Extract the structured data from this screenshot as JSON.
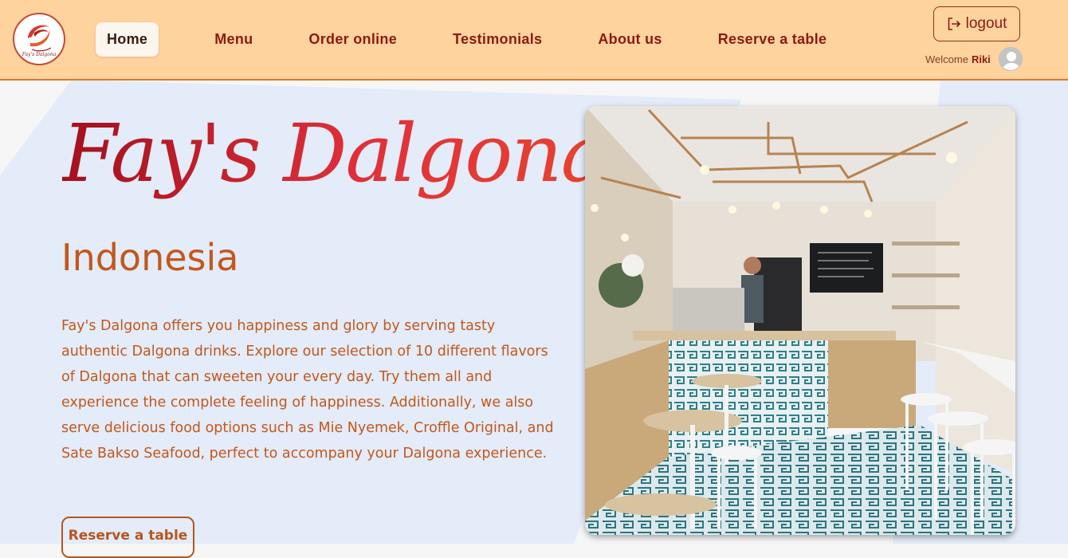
{
  "brand": {
    "logo_text": "Fay's Dalgona",
    "accent": "#ffd39e",
    "text_dark_red": "#8b1a10",
    "orange_text": "#c4571b"
  },
  "nav": {
    "links": [
      {
        "label": "Home",
        "active": true
      },
      {
        "label": "Menu"
      },
      {
        "label": "Order online"
      },
      {
        "label": "Testimonials"
      },
      {
        "label": "About us"
      },
      {
        "label": "Reserve a table"
      }
    ],
    "logout_label": "logout",
    "logout_icon": "logout-icon",
    "welcome_prefix": "Welcome",
    "username": "Riki",
    "avatar_icon": "user-avatar-icon"
  },
  "hero": {
    "title": "Fay's Dalgona",
    "subtitle": "Indonesia",
    "description": "Fay's Dalgona offers you happiness and glory by serving tasty authentic Dalgona drinks. Explore our selection of 10 different flavors of Dalgona that can sweeten your every day. Try them all and experience the complete feeling of happiness. Additionally, we also serve delicious food options such as Mie Nyemek, Croffle Original, and Sate Bakso Seafood, perfect to accompany your Dalgona experience.",
    "reserve_label": "Reserve a table"
  }
}
